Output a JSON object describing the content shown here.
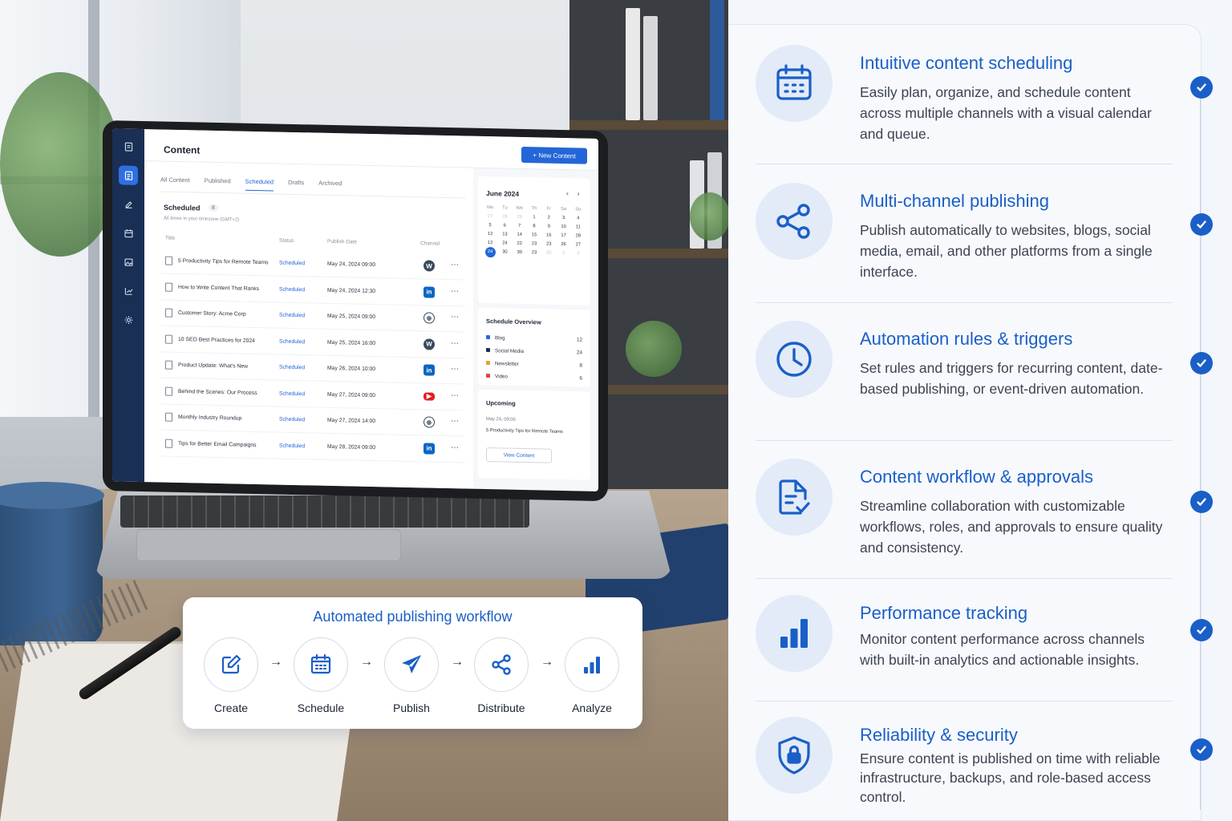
{
  "colors": {
    "accent": "#1a5fc7",
    "app_sidebar": "#1a2f55",
    "button": "#2466d8"
  },
  "app": {
    "title": "Content",
    "new_button": "+ New Content",
    "tabs": [
      "All Content",
      "Published",
      "Scheduled",
      "Drafts",
      "Archived"
    ],
    "active_tab": "Scheduled",
    "section_title": "Scheduled",
    "section_count": "8",
    "timezone_note": "All times in your timezone (GMT+2)",
    "columns": [
      "Title",
      "Status",
      "Publish Date",
      "Channel"
    ],
    "rows": [
      {
        "title": "5 Productivity Tips for Remote Teams",
        "status": "Scheduled",
        "date": "May 24, 2024 09:00",
        "channel": "wordpress-icon"
      },
      {
        "title": "How to Write Content That Ranks",
        "status": "Scheduled",
        "date": "May 24, 2024 12:30",
        "channel": "linkedin-icon"
      },
      {
        "title": "Customer Story: Acme Corp",
        "status": "Scheduled",
        "date": "May 25, 2024 09:00",
        "channel": "globe-icon"
      },
      {
        "title": "10 SEO Best Practices for 2024",
        "status": "Scheduled",
        "date": "May 25, 2024 16:00",
        "channel": "wordpress-icon"
      },
      {
        "title": "Product Update: What's New",
        "status": "Scheduled",
        "date": "May 26, 2024 10:00",
        "channel": "linkedin-icon"
      },
      {
        "title": "Behind the Scenes: Our Process",
        "status": "Scheduled",
        "date": "May 27, 2024 09:00",
        "channel": "youtube-icon"
      },
      {
        "title": "Monthly Industry Roundup",
        "status": "Scheduled",
        "date": "May 27, 2024 14:00",
        "channel": "globe-icon"
      },
      {
        "title": "Tips for Better Email Campaigns",
        "status": "Scheduled",
        "date": "May 28, 2024 09:00",
        "channel": "linkedin-icon"
      }
    ],
    "calendar": {
      "month": "June 2024",
      "nav": "‹ ›",
      "weekdays": [
        "Mo",
        "Tu",
        "We",
        "Th",
        "Fr",
        "Sa",
        "Su"
      ],
      "days": [
        "27",
        "28",
        "29",
        "1",
        "2",
        "3",
        "4",
        "5",
        "6",
        "7",
        "8",
        "9",
        "10",
        "11",
        "12",
        "13",
        "14",
        "15",
        "16",
        "17",
        "28",
        "12",
        "24",
        "22",
        "23",
        "23",
        "26",
        "27",
        "24",
        "30",
        "30",
        "23",
        "30",
        "2",
        "3"
      ],
      "dim_days_idx": [
        0,
        1,
        2,
        32,
        33,
        34
      ],
      "selected_idx": 28
    },
    "overview": {
      "title": "Schedule Overview",
      "items": [
        {
          "label": "Blog",
          "count": "12",
          "color": "#2466d8"
        },
        {
          "label": "Social Media",
          "count": "24",
          "color": "#1a2f55"
        },
        {
          "label": "Newsletter",
          "count": "8",
          "color": "#e0a030"
        },
        {
          "label": "Video",
          "count": "6",
          "color": "#e04040"
        }
      ]
    },
    "upcoming": {
      "title": "Upcoming",
      "date": "May 24, 09:00",
      "item": "5 Productivity Tips for Remote Teams",
      "button": "View Content"
    }
  },
  "workflow": {
    "title": "Automated publishing workflow",
    "steps": [
      {
        "label": "Create",
        "icon": "edit-icon"
      },
      {
        "label": "Schedule",
        "icon": "calendar-icon"
      },
      {
        "label": "Publish",
        "icon": "send-icon"
      },
      {
        "label": "Distribute",
        "icon": "share-icon"
      },
      {
        "label": "Analyze",
        "icon": "bar-chart-icon"
      }
    ],
    "arrow": "→"
  },
  "features": [
    {
      "title": "Intuitive content scheduling",
      "desc": "Easily plan, organize, and schedule content across multiple channels with a visual calendar and queue.",
      "icon": "calendar-icon"
    },
    {
      "title": "Multi-channel publishing",
      "desc": "Publish automatically to websites, blogs, social media, email, and other platforms from a single interface.",
      "icon": "share-icon"
    },
    {
      "title": "Automation rules & triggers",
      "desc": "Set rules and triggers for recurring content, date-based publishing, or event-driven automation.",
      "icon": "clock-icon"
    },
    {
      "title": "Content workflow & approvals",
      "desc": "Streamline collaboration with customizable workflows, roles, and approvals to ensure quality and consistency.",
      "icon": "document-check-icon"
    },
    {
      "title": "Performance tracking",
      "desc": "Monitor content performance across channels with built-in analytics and actionable insights.",
      "icon": "bar-chart-icon"
    },
    {
      "title": "Reliability & security",
      "desc": "Ensure content is published on time with reliable infrastructure, backups, and role-based access control.",
      "icon": "shield-lock-icon"
    }
  ]
}
